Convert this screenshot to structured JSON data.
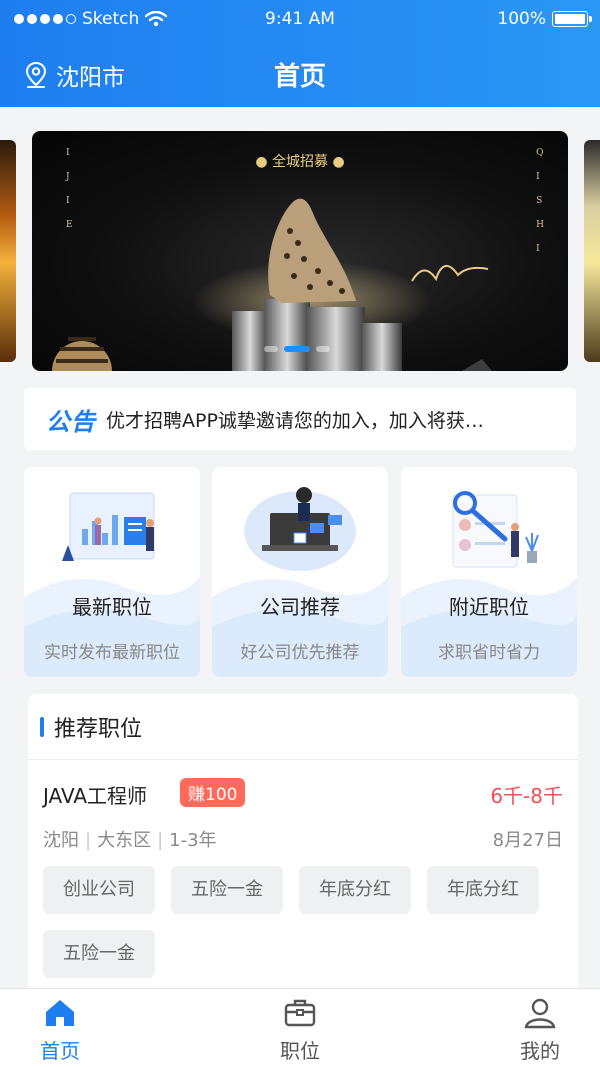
{
  "status_bar": {
    "carrier": "Sketch",
    "time": "9:41 AM",
    "battery": "100%"
  },
  "nav": {
    "city": "沈阳市",
    "title": "首页"
  },
  "banner": {
    "headline": "全城招募",
    "left_letters": "I\nJ\nI\nE",
    "right_letters": "Q\nI\nS\nH\nI",
    "active_index": 1,
    "slide_count": 3
  },
  "notice": {
    "tag": "公告",
    "text": "优才招聘APP诚挚邀请您的加入，加入将获…"
  },
  "features": [
    {
      "title": "最新职位",
      "subtitle": "实时发布最新职位"
    },
    {
      "title": "公司推荐",
      "subtitle": "好公司优先推荐"
    },
    {
      "title": "附近职位",
      "subtitle": "求职省时省力"
    }
  ],
  "recommended": {
    "heading": "推荐职位",
    "job": {
      "title": "JAVA工程师",
      "badge": "赚100",
      "salary": "6千-8千",
      "city": "沈阳",
      "district": "大东区",
      "experience": "1-3年",
      "date": "8月27日",
      "tags": [
        "创业公司",
        "五险一金",
        "年底分红",
        "年底分红",
        "五险一金"
      ]
    }
  },
  "tabbar": [
    {
      "label": "首页",
      "icon": "home-icon",
      "active": true
    },
    {
      "label": "职位",
      "icon": "briefcase-icon",
      "active": false
    },
    {
      "label": "我的",
      "icon": "user-icon",
      "active": false
    }
  ],
  "colors": {
    "primary": "#1e7ef0",
    "salary": "#f24f57",
    "badge": "#ff6a5a"
  }
}
